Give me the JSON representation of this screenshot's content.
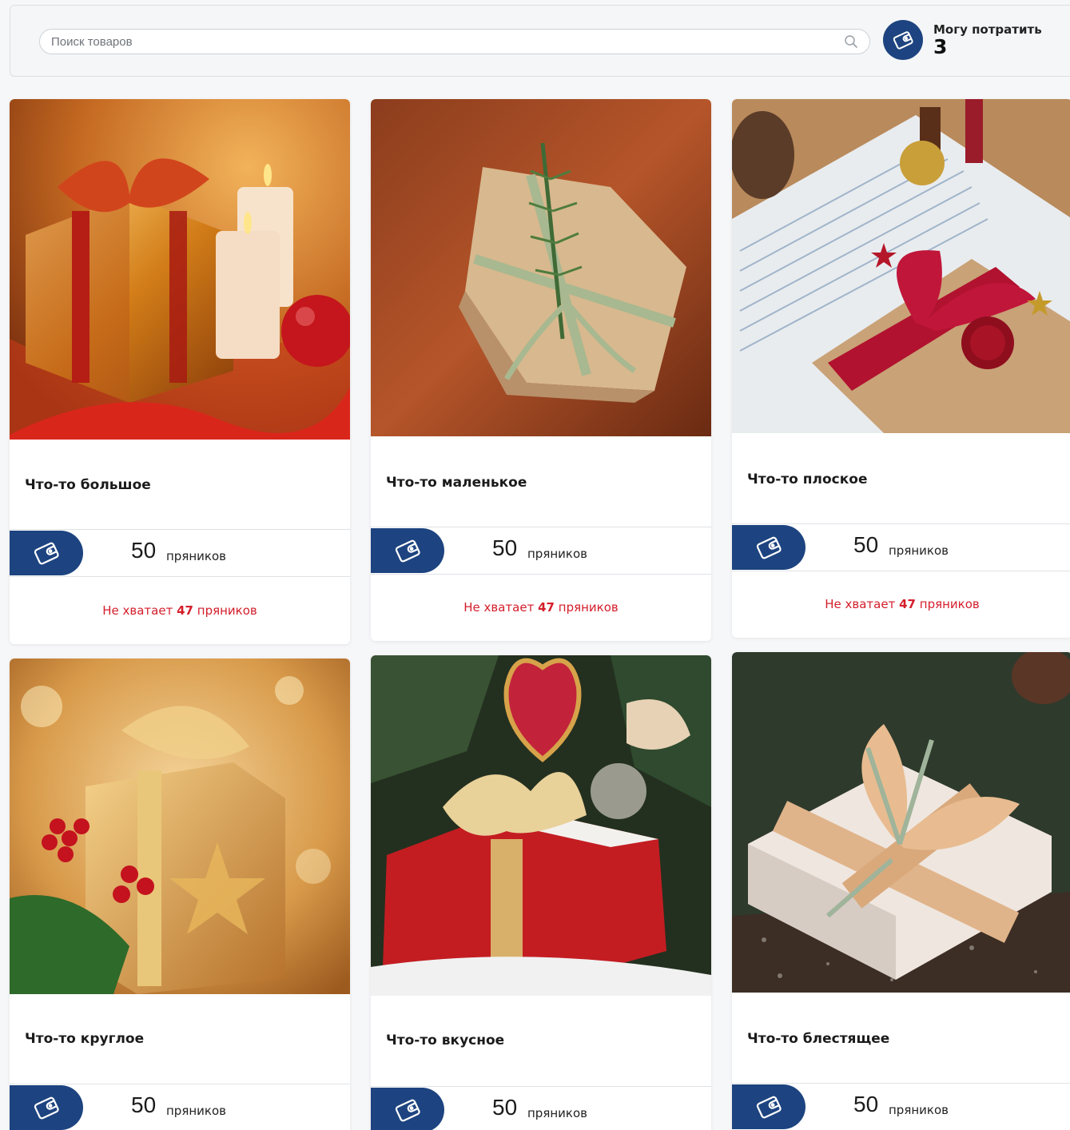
{
  "search": {
    "placeholder": "Поиск товаров"
  },
  "balance": {
    "label": "Могу потратить",
    "value": "3"
  },
  "colors": {
    "accent": "#1d4480",
    "warning": "#d41e2b"
  },
  "products": [
    {
      "title": "Что-то большое",
      "price": "50",
      "unit": "пряников",
      "shortage_prefix": "Не хватает",
      "shortage_amount": "47",
      "shortage_unit": "пряников"
    },
    {
      "title": "Что-то маленькое",
      "price": "50",
      "unit": "пряников",
      "shortage_prefix": "Не хватает",
      "shortage_amount": "47",
      "shortage_unit": "пряников"
    },
    {
      "title": "Что-то плоское",
      "price": "50",
      "unit": "пряников",
      "shortage_prefix": "Не хватает",
      "shortage_amount": "47",
      "shortage_unit": "пряников"
    },
    {
      "title": "Что-то круглое",
      "price": "50",
      "unit": "пряников"
    },
    {
      "title": "Что-то вкусное",
      "price": "50",
      "unit": "пряников"
    },
    {
      "title": "Что-то блестящее",
      "price": "50",
      "unit": "пряников"
    }
  ]
}
